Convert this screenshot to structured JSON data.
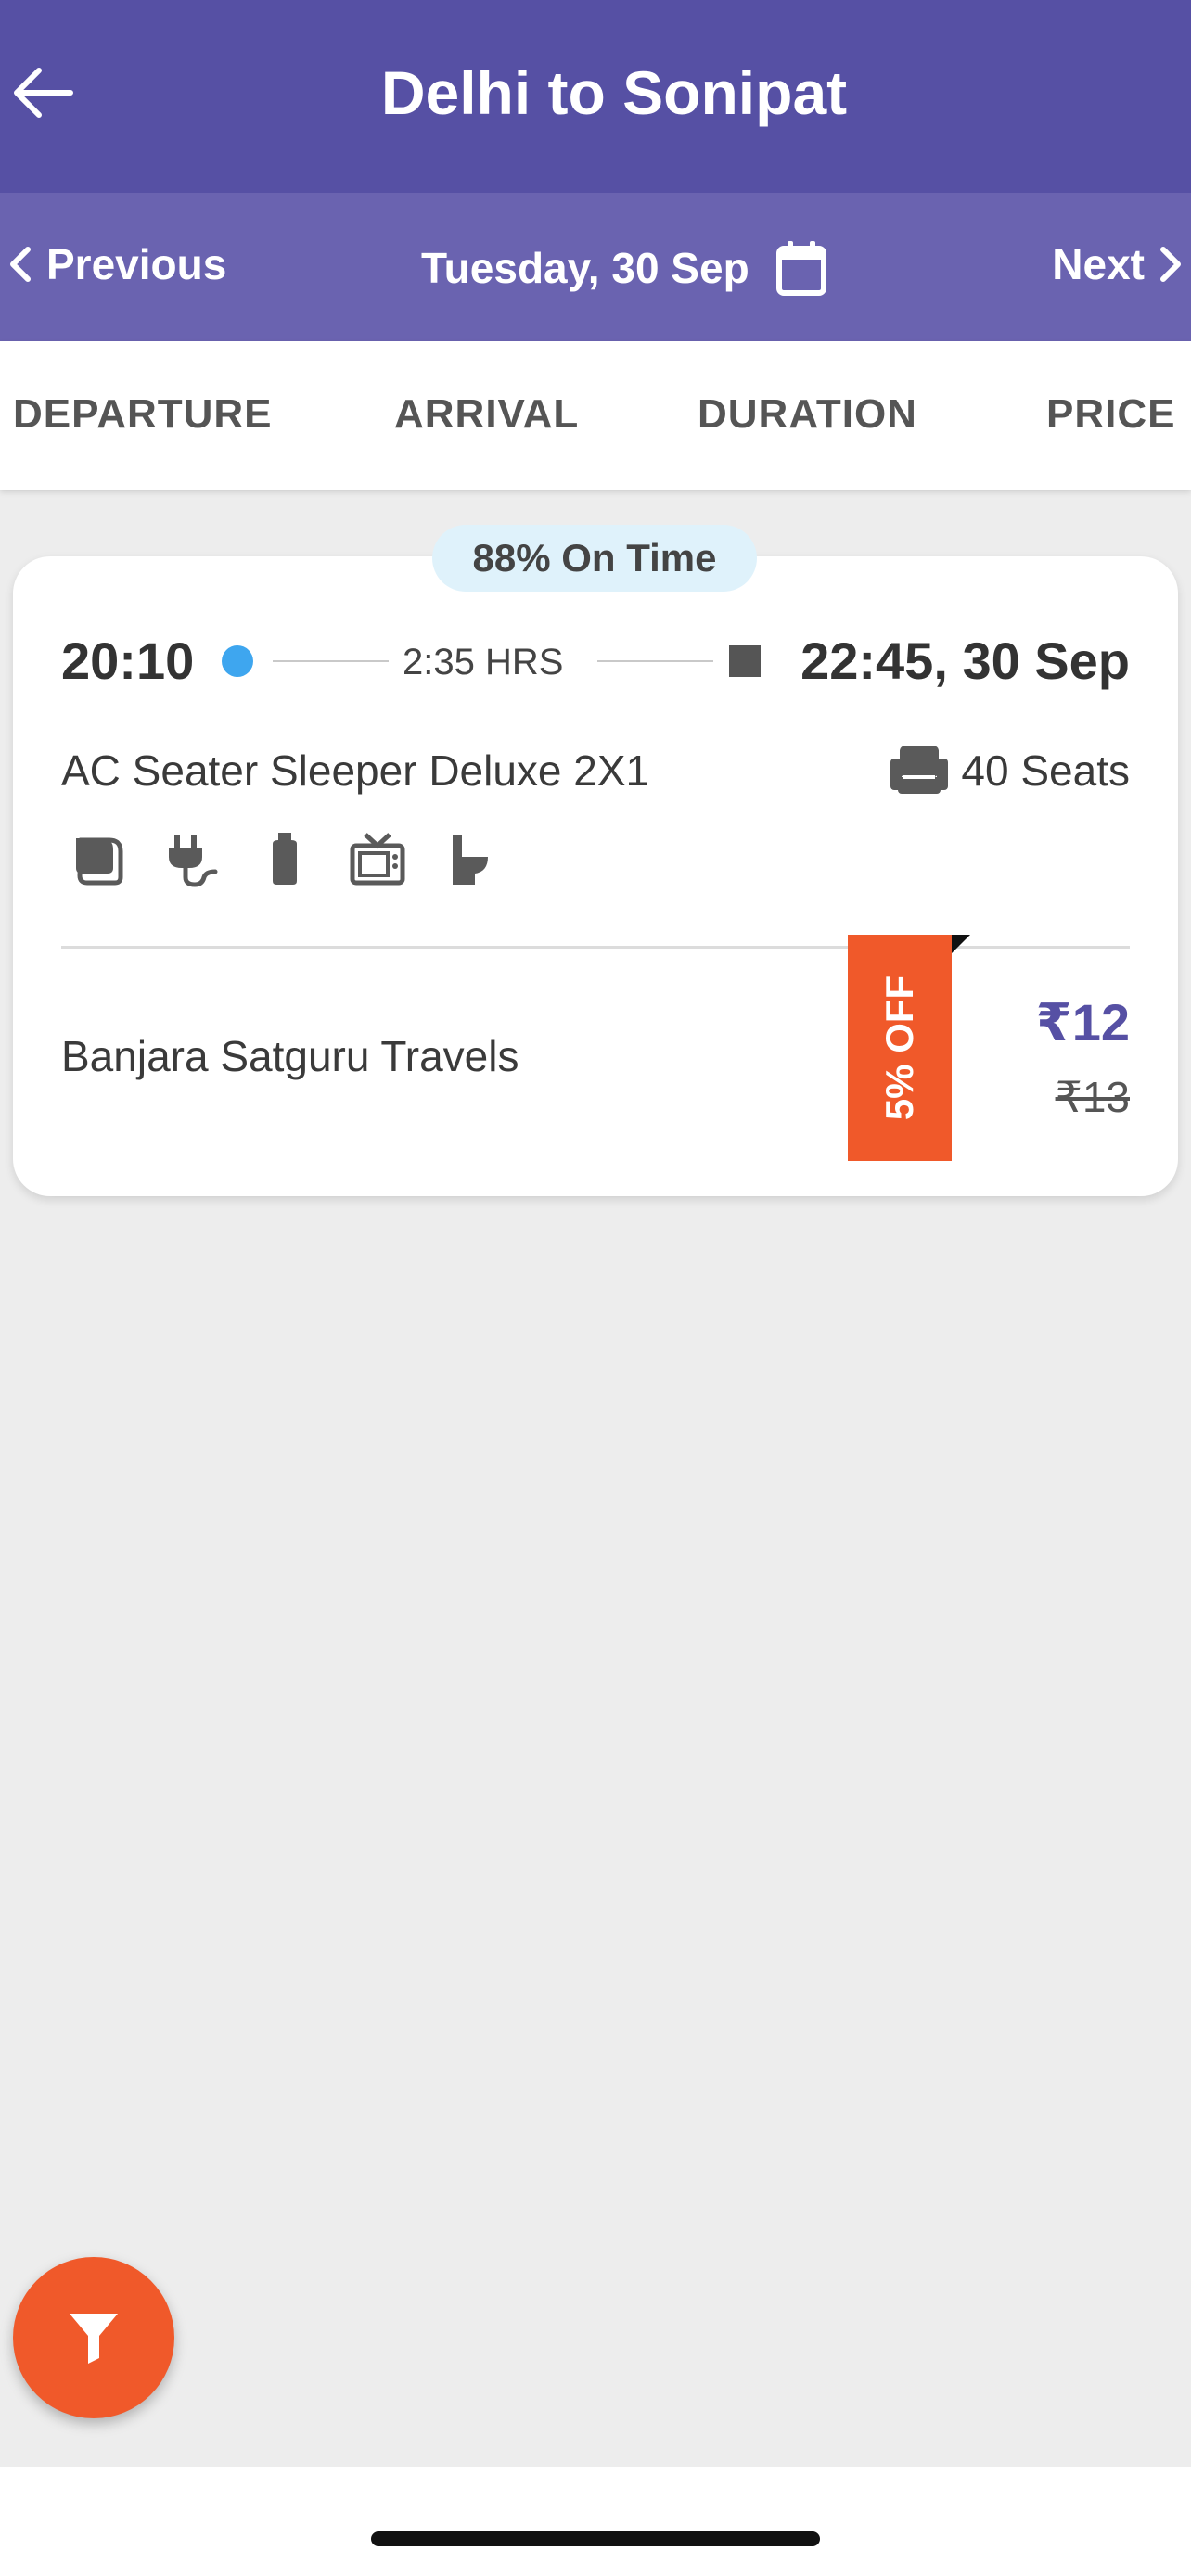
{
  "header": {
    "title": "Delhi to Sonipat"
  },
  "datebar": {
    "previous": "Previous",
    "date": "Tuesday, 30 Sep",
    "next": "Next"
  },
  "sort_tabs": [
    "DEPARTURE",
    "ARRIVAL",
    "DURATION",
    "PRICE"
  ],
  "result": {
    "on_time_badge": "88% On Time",
    "departure_time": "20:10",
    "duration": "2:35 HRS",
    "arrival": "22:45, 30 Sep",
    "bus_type": "AC Seater Sleeper Deluxe 2X1",
    "seats": "40 Seats",
    "amenities": [
      "blanket-icon",
      "charging-point-icon",
      "water-bottle-icon",
      "tv-icon",
      "toilet-icon"
    ],
    "operator": "Banjara Satguru Travels",
    "offer": "5% OFF",
    "price": "₹12",
    "original_price": "₹13"
  },
  "colors": {
    "primary": "#5650a4",
    "primary_light": "#6a63b0",
    "accent": "#f0592a",
    "dot": "#3ea6ef"
  }
}
